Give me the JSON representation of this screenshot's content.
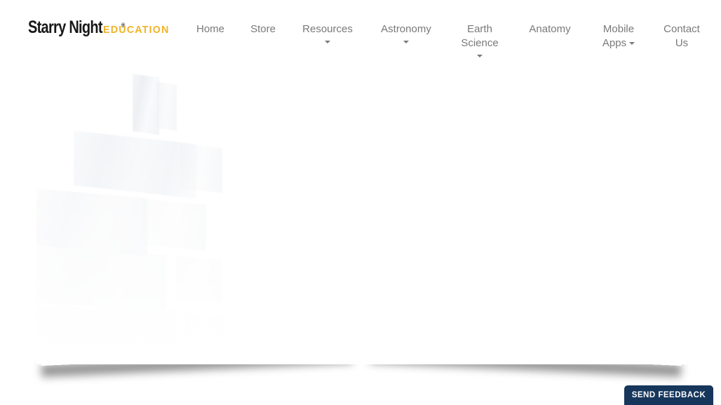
{
  "header": {
    "logo": {
      "brand_name": "Starry Night",
      "registered_mark": "®",
      "sub_brand": "EDUCATION",
      "brand_color": "#181818",
      "sub_brand_color": "#f0b429"
    },
    "nav": {
      "text_color": "#79797b",
      "items": [
        {
          "label": "Home",
          "has_dropdown": false,
          "caret_position": "none"
        },
        {
          "label": "Store",
          "has_dropdown": false,
          "caret_position": "none"
        },
        {
          "label": "Resources",
          "has_dropdown": true,
          "caret_position": "below"
        },
        {
          "label": "Astronomy",
          "has_dropdown": true,
          "caret_position": "below"
        },
        {
          "label": "Earth Science",
          "label_line1": "Earth",
          "label_line2": "Science",
          "has_dropdown": true,
          "caret_position": "below"
        },
        {
          "label": "Anatomy",
          "has_dropdown": false,
          "caret_position": "none"
        },
        {
          "label": "Mobile Apps",
          "label_line1": "Mobile",
          "label_line2": "Apps",
          "has_dropdown": true,
          "caret_position": "inline"
        },
        {
          "label": "Contact Us",
          "label_line1": "Contact",
          "label_line2": "Us",
          "has_dropdown": false,
          "caret_position": "none"
        }
      ]
    }
  },
  "main": {
    "panel": {
      "state": "loading",
      "background_color": "#ffffff"
    }
  },
  "feedback": {
    "label": "SEND FEEDBACK",
    "background_color": "#16365c",
    "text_color": "#ffffff"
  }
}
